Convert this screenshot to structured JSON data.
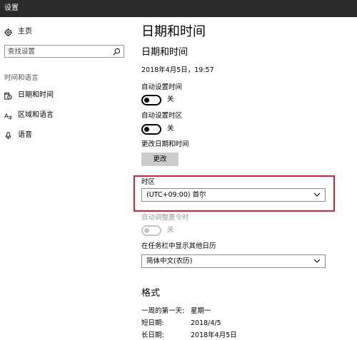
{
  "window": {
    "title": "设置"
  },
  "sidebar": {
    "home_label": "主页",
    "search_placeholder": "查找设置",
    "section_title": "时间和语言",
    "items": [
      {
        "label": "日期和时间",
        "icon": "calendar-clock-icon",
        "selected": true
      },
      {
        "label": "区域和语言",
        "icon": "region-language-icon",
        "selected": false
      },
      {
        "label": "语音",
        "icon": "microphone-icon",
        "selected": false
      }
    ]
  },
  "main": {
    "page_title": "日期和时间",
    "sub_title": "日期和时间",
    "current_datetime": "2018年4月5日，19:57",
    "auto_time": {
      "label": "自动设置时间",
      "state": "关"
    },
    "auto_timezone": {
      "label": "自动设置时区",
      "state": "关"
    },
    "change_datetime": {
      "label": "更改日期和时间",
      "button": "更改"
    },
    "timezone": {
      "label": "时区",
      "value": "(UTC+09:00) 首尔"
    },
    "dst": {
      "label": "自动调整夏令时",
      "state": "关"
    },
    "taskbar_calendar": {
      "label": "在任务栏中显示其他日历",
      "value": "简体中文(农历)"
    },
    "format": {
      "heading": "格式",
      "rows": [
        {
          "key": "一周的第一天:",
          "value": "星期一"
        },
        {
          "key": "短日期:",
          "value": "2018/4/5"
        },
        {
          "key": "长日期:",
          "value": "2018年4月5日"
        }
      ]
    },
    "highlight_color": "#e0212b"
  }
}
